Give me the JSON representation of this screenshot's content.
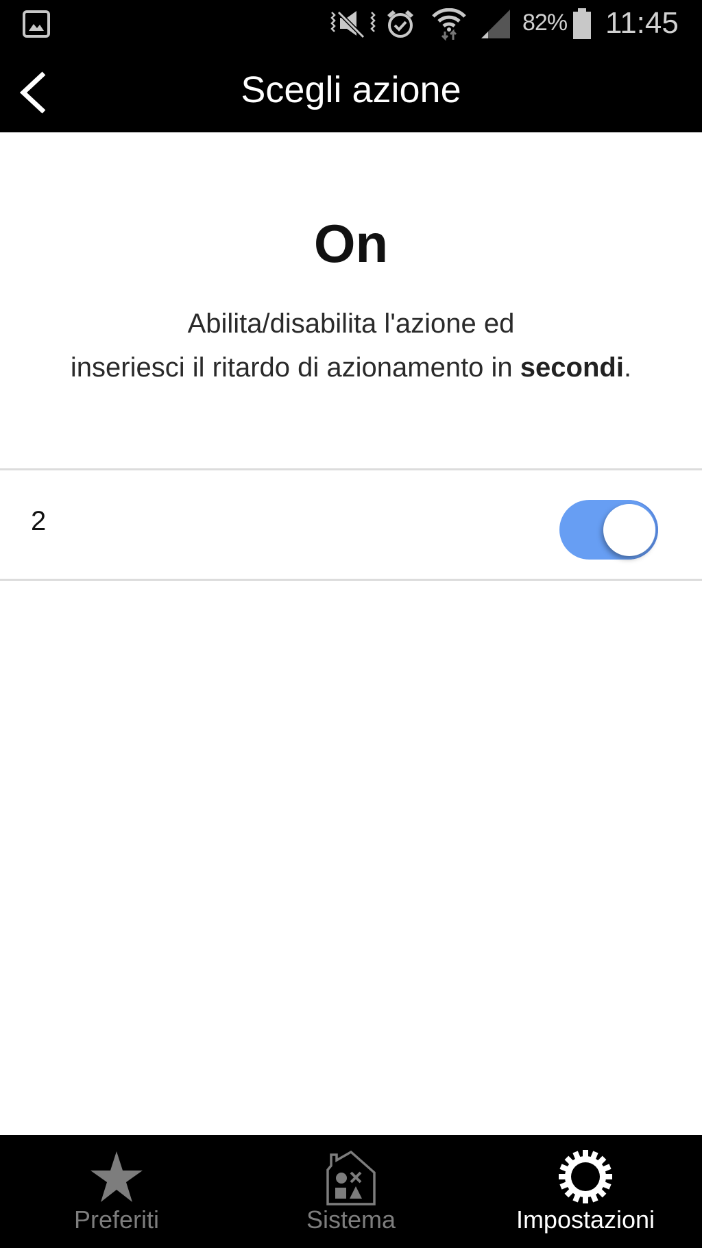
{
  "status_bar": {
    "battery_percent": "82%",
    "time": "11:45",
    "icons": [
      "gallery-notification-icon",
      "vibrate-mute-icon",
      "alarm-icon",
      "wifi-data-icon",
      "cellular-signal-icon",
      "battery-icon"
    ]
  },
  "app_bar": {
    "back_icon": "chevron-left-icon",
    "title": "Scegli azione"
  },
  "content": {
    "heading": "On",
    "description_line1": "Abilita/disabilita l'azione ed",
    "description_line2_prefix": "inseriesci il ritardo di azionamento in ",
    "description_line2_bold": "secondi",
    "description_line2_suffix": "."
  },
  "action_row": {
    "delay_value": "2",
    "enabled": true,
    "toggle_color": "#679ef3"
  },
  "tab_bar": {
    "tabs": [
      {
        "label": "Preferiti",
        "icon": "star-icon",
        "active": false
      },
      {
        "label": "Sistema",
        "icon": "house-icon",
        "active": false
      },
      {
        "label": "Impostazioni",
        "icon": "gear-icon",
        "active": true
      }
    ]
  }
}
